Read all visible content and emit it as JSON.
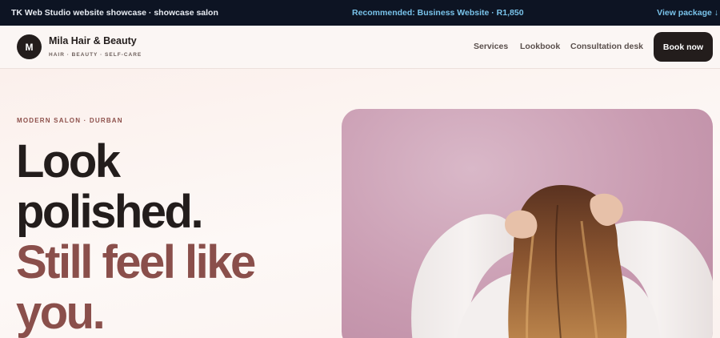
{
  "promo": {
    "left_text": "TK Web Studio website showcase · showcase salon",
    "center_text": "Recommended: Business Website · R1,850",
    "right_link": "View package ↓"
  },
  "header": {
    "logo_letter": "M",
    "brand_name": "Mila Hair & Beauty",
    "tagline": "HAIR · BEAUTY · SELF-CARE",
    "nav": [
      "Services",
      "Lookbook",
      "Consultation desk"
    ],
    "book_label": "Book now"
  },
  "hero": {
    "eyebrow": "MODERN SALON · DURBAN",
    "headline_line1": "Look",
    "headline_line2": "polished.",
    "headline_line3": "Still feel like",
    "headline_line4": "you.",
    "accent_color": "#8a4f4b"
  },
  "colors": {
    "promo_bg": "#0d1423",
    "promo_accent": "#79c3ea",
    "button_bg": "#231d1c"
  }
}
